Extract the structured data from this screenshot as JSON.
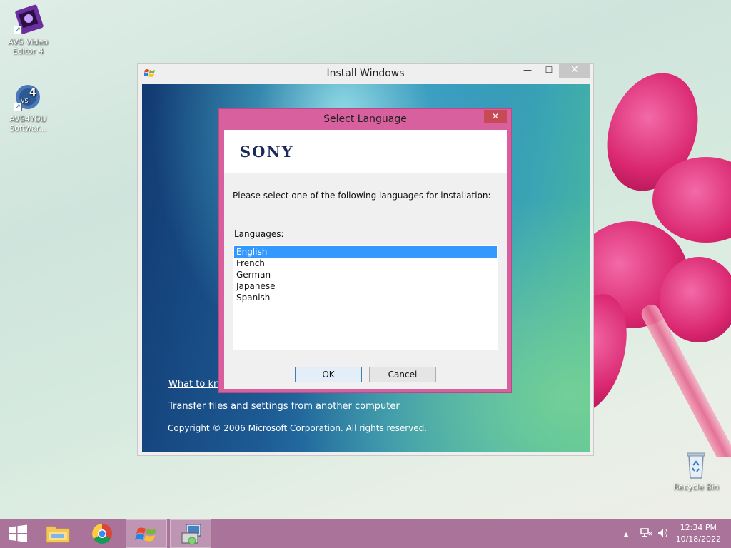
{
  "desktop": {
    "icons": [
      {
        "label_line1": "AVS Video",
        "label_line2": "Editor 4"
      },
      {
        "label_line1": "AVS4YOU",
        "label_line2": "Softwar..."
      },
      {
        "label_line1": "Recycle Bin",
        "label_line2": ""
      }
    ]
  },
  "install_window": {
    "title": "Install Windows",
    "minimize_glyph": "—",
    "maximize_glyph": "☐",
    "close_glyph": "✕",
    "link_what_to_know": "What to kno",
    "link_transfer": "Transfer files and settings from another computer",
    "copyright": "Copyright © 2006 Microsoft Corporation. All rights reserved."
  },
  "dialog": {
    "title": "Select Language",
    "close_glyph": "✕",
    "brand": "SONY",
    "prompt": "Please select one of the following languages for installation:",
    "languages_label": "Languages:",
    "languages": [
      "English",
      "French",
      "German",
      "Japanese",
      "Spanish"
    ],
    "selected_index": 0,
    "ok_label": "OK",
    "cancel_label": "Cancel"
  },
  "taskbar": {
    "clock_time": "12:34 PM",
    "clock_date": "10/18/2022",
    "tray_arrow": "▲"
  },
  "colors": {
    "dialog_frame": "#d9609e",
    "taskbar": "#a9739a",
    "selection": "#3399ff"
  }
}
